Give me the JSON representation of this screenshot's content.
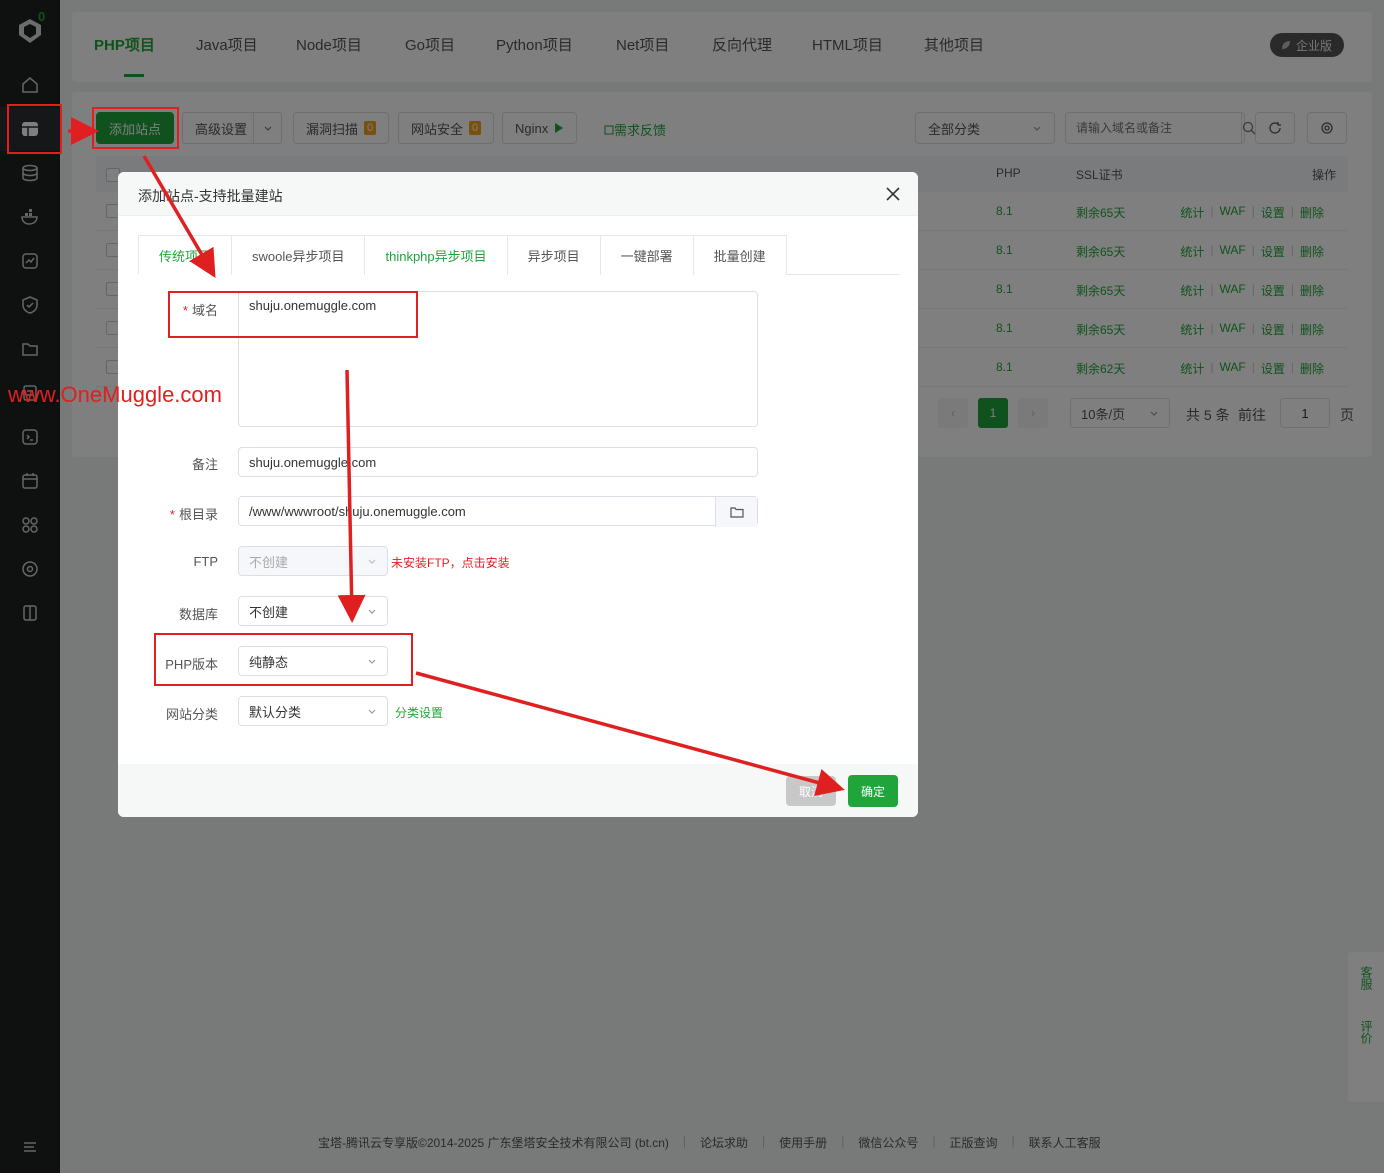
{
  "sidebar": {
    "badge_count": "0"
  },
  "top_tabs": [
    "PHP项目",
    "Java项目",
    "Node项目",
    "Go项目",
    "Python项目",
    "Net项目",
    "反向代理",
    "HTML项目",
    "其他项目"
  ],
  "enterprise_label": "企业版",
  "toolbar": {
    "add_site": "添加站点",
    "advanced": "高级设置",
    "vuln_scan": "漏洞扫描",
    "vuln_count": "0",
    "site_security": "网站安全",
    "security_count": "0",
    "nginx": "Nginx",
    "feedback": "需求反馈",
    "category": "全部分类",
    "search_placeholder": "请输入域名或备注"
  },
  "table": {
    "headers": {
      "php": "PHP",
      "ssl": "SSL证书",
      "ops": "操作"
    },
    "rows": [
      {
        "php": "8.1",
        "ssl": "剩余65天"
      },
      {
        "php": "8.1",
        "ssl": "剩余65天"
      },
      {
        "php": "8.1",
        "ssl": "剩余65天"
      },
      {
        "php": "8.1",
        "ssl": "剩余65天"
      },
      {
        "php": "8.1",
        "ssl": "剩余62天"
      }
    ],
    "ops": [
      "统计",
      "WAF",
      "设置",
      "删除"
    ]
  },
  "pager": {
    "current": "1",
    "page_size": "10条/页",
    "total": "共 5 条",
    "goto": "前往",
    "goto_value": "1",
    "page_unit": "页"
  },
  "dialog": {
    "title": "添加站点-支持批量建站",
    "tabs": [
      "传统项目",
      "swoole异步项目",
      "thinkphp异步项目",
      "异步项目",
      "一键部署",
      "批量创建"
    ],
    "domain_label": "域名",
    "domain_value": "shuju.onemuggle.com",
    "remark_label": "备注",
    "remark_value": "shuju.onemuggle.com",
    "root_label": "根目录",
    "root_value": "/www/wwwroot/shuju.onemuggle.com",
    "ftp_label": "FTP",
    "ftp_value": "不创建",
    "ftp_warning": "未安装FTP，点击安装",
    "db_label": "数据库",
    "db_value": "不创建",
    "php_label": "PHP版本",
    "php_value": "纯静态",
    "category_label": "网站分类",
    "category_value": "默认分类",
    "category_settings": "分类设置",
    "cancel": "取消",
    "ok": "确定"
  },
  "footer": [
    "宝塔-腾讯云专享版©2014-2025 广东堡塔安全技术有限公司 (bt.cn)",
    "论坛求助",
    "使用手册",
    "微信公众号",
    "正版查询",
    "联系人工客服"
  ],
  "side_float": {
    "service": "客服",
    "rate": "评价"
  },
  "watermark": "www.OneMuggle.com",
  "colors": {
    "brand_green": "#20a53a",
    "annotation_red": "#e02020"
  }
}
